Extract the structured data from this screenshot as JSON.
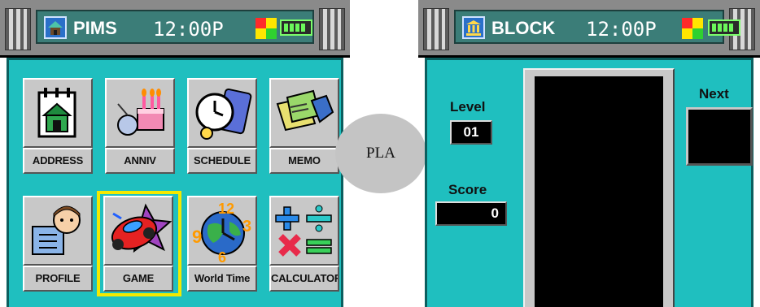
{
  "pims": {
    "title": "PIMS",
    "clock": "12:00P",
    "title_icon": "home-icon",
    "tiles": [
      {
        "label": "ADDRESS",
        "icon": "address-book-icon"
      },
      {
        "label": "ANNIV",
        "icon": "birthday-cake-icon"
      },
      {
        "label": "SCHEDULE",
        "icon": "clock-calendar-icon"
      },
      {
        "label": "MEMO",
        "icon": "memo-notes-icon"
      },
      {
        "label": "PROFILE",
        "icon": "profile-person-icon"
      },
      {
        "label": "GAME",
        "icon": "race-car-icon",
        "selected": true
      },
      {
        "label": "World Time",
        "icon": "globe-clock-icon"
      },
      {
        "label": "CALCULATOR",
        "icon": "math-symbols-icon"
      }
    ]
  },
  "bubble": {
    "text": "PLA"
  },
  "block": {
    "title": "BLOCK",
    "clock": "12:00P",
    "title_icon": "bank-icon",
    "level_label": "Level",
    "level_value": "01",
    "score_label": "Score",
    "score_value": "0",
    "next_label": "Next"
  },
  "colors": {
    "content_bg": "#1fbfbf",
    "titlebar_bg": "#8a8a8a",
    "titlebox_bg": "#3b7d78",
    "selection": "#f4e900"
  }
}
